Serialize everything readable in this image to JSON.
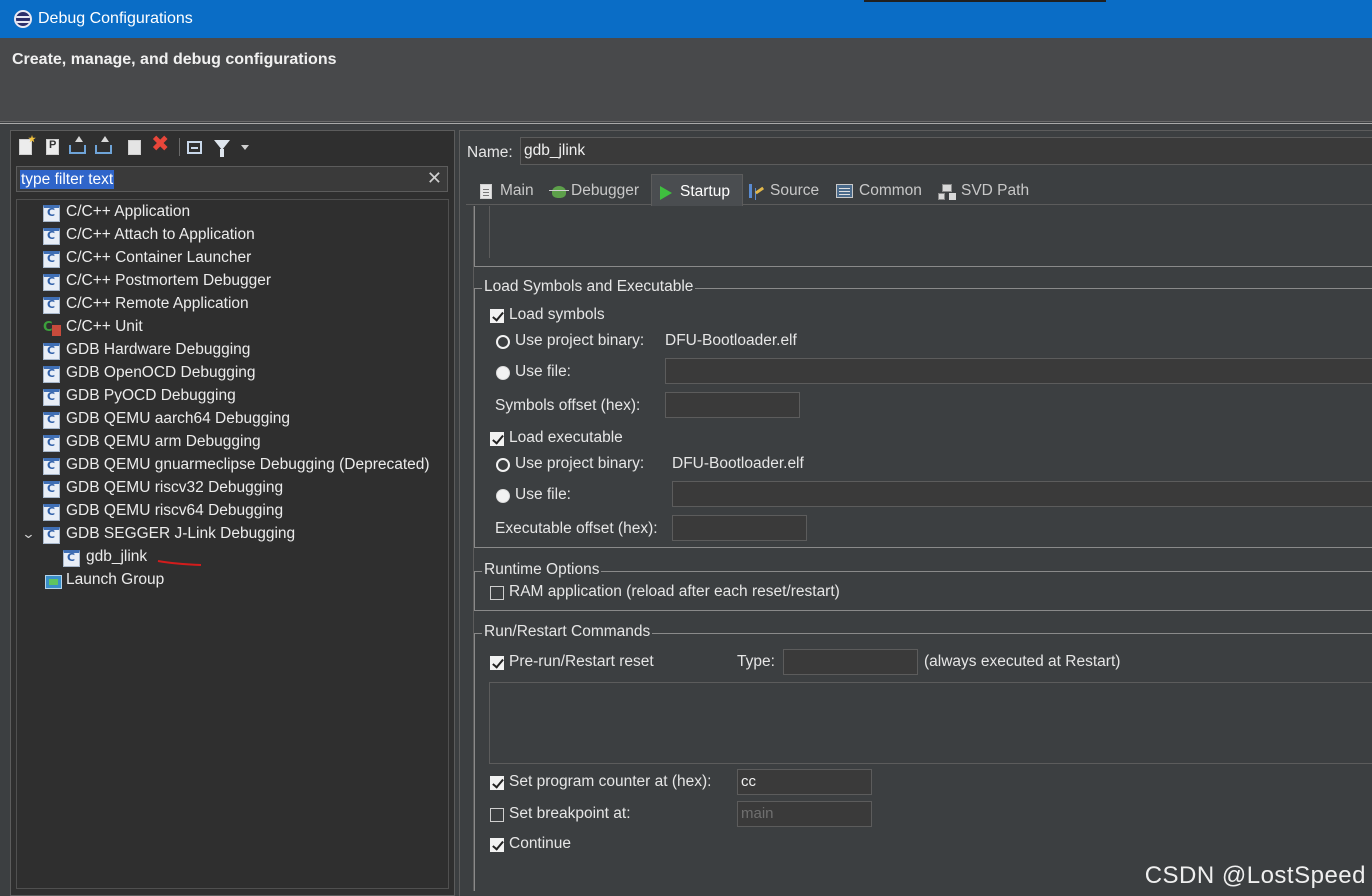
{
  "window": {
    "title": "Debug Configurations"
  },
  "header": {
    "heading": "Create, manage, and debug configurations"
  },
  "left": {
    "filter_text": "type filter text",
    "clear_glyph": "✕",
    "tree": [
      {
        "label": "C/C++ Application",
        "icon": "c-launch-icon"
      },
      {
        "label": "C/C++ Attach to Application",
        "icon": "c-launch-icon"
      },
      {
        "label": "C/C++ Container Launcher",
        "icon": "c-launch-icon"
      },
      {
        "label": "C/C++ Postmortem Debugger",
        "icon": "c-launch-icon"
      },
      {
        "label": "C/C++ Remote Application",
        "icon": "c-launch-icon"
      },
      {
        "label": "C/C++ Unit",
        "icon": "c-unit-icon"
      },
      {
        "label": "GDB Hardware Debugging",
        "icon": "c-launch-icon"
      },
      {
        "label": "GDB OpenOCD Debugging",
        "icon": "c-launch-icon"
      },
      {
        "label": "GDB PyOCD Debugging",
        "icon": "c-launch-icon"
      },
      {
        "label": "GDB QEMU aarch64 Debugging",
        "icon": "c-launch-icon"
      },
      {
        "label": "GDB QEMU arm Debugging",
        "icon": "c-launch-icon"
      },
      {
        "label": "GDB QEMU gnuarmeclipse Debugging (Deprecated)",
        "icon": "c-launch-icon"
      },
      {
        "label": "GDB QEMU riscv32 Debugging",
        "icon": "c-launch-icon"
      },
      {
        "label": "GDB QEMU riscv64 Debugging",
        "icon": "c-launch-icon"
      },
      {
        "label": "GDB SEGGER J-Link Debugging",
        "icon": "c-launch-icon",
        "expanded": true
      },
      {
        "label": "gdb_jlink",
        "icon": "c-launch-icon",
        "child": true,
        "selected": true
      },
      {
        "label": "Launch Group",
        "icon": "launch-group-icon"
      }
    ]
  },
  "right": {
    "name_label": "Name:",
    "name_value": "gdb_jlink",
    "tabs": [
      "Main",
      "Debugger",
      "Startup",
      "Source",
      "Common",
      "SVD Path"
    ],
    "active_tab": "Startup",
    "load_group": {
      "title": "Load Symbols and Executable",
      "load_symbols": {
        "label": "Load symbols",
        "checked": true
      },
      "sym_use_project": {
        "label": "Use project binary:",
        "value": "DFU-Bootloader.elf",
        "selected": true
      },
      "sym_use_file": {
        "label": "Use file:",
        "value": ""
      },
      "symbols_offset": {
        "label": "Symbols offset (hex):",
        "value": ""
      },
      "load_executable": {
        "label": "Load executable",
        "checked": true
      },
      "exe_use_project": {
        "label": "Use project binary:",
        "value": "DFU-Bootloader.elf",
        "selected": true
      },
      "exe_use_file": {
        "label": "Use file:",
        "value": ""
      },
      "exe_offset": {
        "label": "Executable offset (hex):",
        "value": ""
      }
    },
    "runtime_group": {
      "title": "Runtime Options",
      "ram_app": {
        "label": "RAM application (reload after each reset/restart)",
        "checked": false
      }
    },
    "restart_group": {
      "title": "Run/Restart Commands",
      "pre_run": {
        "label": "Pre-run/Restart reset",
        "checked": true
      },
      "type_label": "Type:",
      "type_value": "",
      "always_note": "(always executed at Restart)",
      "set_pc": {
        "label": "Set program counter at (hex):",
        "checked": true,
        "value": "cc"
      },
      "set_bp": {
        "label": "Set breakpoint at:",
        "checked": false,
        "placeholder": "main"
      },
      "continue": {
        "label": "Continue",
        "checked": true
      }
    }
  },
  "watermark": "CSDN @LostSpeed",
  "colors": {
    "titlebar": "#0a6dc6",
    "selection": "#2f65ca",
    "annotation": "#d21c1c"
  }
}
